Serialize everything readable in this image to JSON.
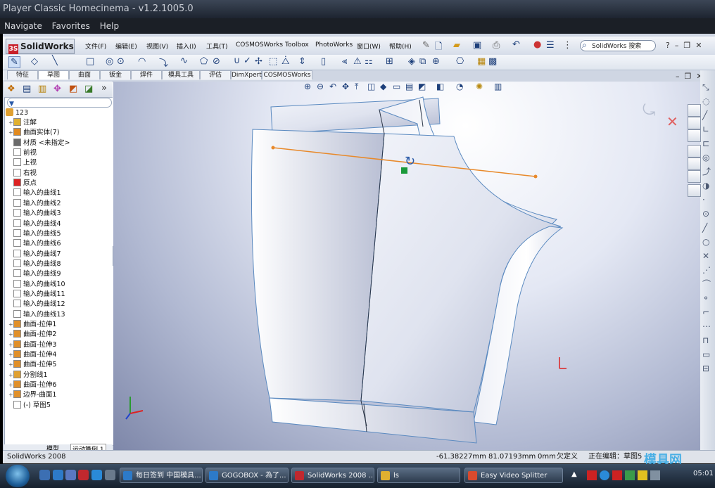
{
  "player": {
    "title": "Player Classic Homecinema - v1.2.1005.0",
    "menu": [
      "Navigate",
      "Favorites",
      "Help"
    ]
  },
  "solidworks": {
    "logo": "SolidWorks",
    "menus": [
      "文件(F)",
      "编辑(E)",
      "视图(V)",
      "插入(I)",
      "工具(T)",
      "COSMOSWorks",
      "Toolbox",
      "PhotoWorks",
      "窗口(W)",
      "帮助(H)"
    ],
    "search_placeholder": "SolidWorks 搜索",
    "command_tabs": [
      "特征",
      "草图",
      "曲面",
      "钣金",
      "焊件",
      "模具工具",
      "评估",
      "DimXpert",
      "COSMOSWorks"
    ],
    "active_tab": "草图"
  },
  "tree": {
    "root": "123",
    "items": [
      {
        "label": "注解",
        "icon": "annotation-icon",
        "expand": "+"
      },
      {
        "label": "曲面实体(7)",
        "icon": "surface-bodies-icon",
        "expand": "+"
      },
      {
        "label": "材质 <未指定>",
        "icon": "material-icon",
        "expand": ""
      },
      {
        "label": "前视",
        "icon": "plane-icon",
        "expand": ""
      },
      {
        "label": "上视",
        "icon": "plane-icon",
        "expand": ""
      },
      {
        "label": "右视",
        "icon": "plane-icon",
        "expand": ""
      },
      {
        "label": "原点",
        "icon": "origin-icon",
        "expand": ""
      },
      {
        "label": "输入的曲线1",
        "icon": "curve-icon",
        "expand": ""
      },
      {
        "label": "输入的曲线2",
        "icon": "curve-icon",
        "expand": ""
      },
      {
        "label": "输入的曲线3",
        "icon": "curve-icon",
        "expand": ""
      },
      {
        "label": "输入的曲线4",
        "icon": "curve-icon",
        "expand": ""
      },
      {
        "label": "输入的曲线5",
        "icon": "curve-icon",
        "expand": ""
      },
      {
        "label": "输入的曲线6",
        "icon": "curve-icon",
        "expand": ""
      },
      {
        "label": "输入的曲线7",
        "icon": "curve-icon",
        "expand": ""
      },
      {
        "label": "输入的曲线8",
        "icon": "curve-icon",
        "expand": ""
      },
      {
        "label": "输入的曲线9",
        "icon": "curve-icon",
        "expand": ""
      },
      {
        "label": "输入的曲线10",
        "icon": "curve-icon",
        "expand": ""
      },
      {
        "label": "输入的曲线11",
        "icon": "curve-icon",
        "expand": ""
      },
      {
        "label": "输入的曲线12",
        "icon": "curve-icon",
        "expand": ""
      },
      {
        "label": "输入的曲线13",
        "icon": "curve-icon",
        "expand": ""
      },
      {
        "label": "曲面-拉伸1",
        "icon": "extrude-icon",
        "expand": "+"
      },
      {
        "label": "曲面-拉伸2",
        "icon": "extrude-icon",
        "expand": "+"
      },
      {
        "label": "曲面-拉伸3",
        "icon": "extrude-icon",
        "expand": "+"
      },
      {
        "label": "曲面-拉伸4",
        "icon": "extrude-icon",
        "expand": "+"
      },
      {
        "label": "曲面-拉伸5",
        "icon": "extrude-icon",
        "expand": "+"
      },
      {
        "label": "分割线1",
        "icon": "split-line-icon",
        "expand": "+"
      },
      {
        "label": "曲面-拉伸6",
        "icon": "extrude-icon",
        "expand": "+"
      },
      {
        "label": "边界-曲面1",
        "icon": "boundary-surface-icon",
        "expand": "+"
      },
      {
        "label": "(-) 草图5",
        "icon": "sketch-icon",
        "expand": ""
      }
    ],
    "bottom_tabs": [
      "模型",
      "运动算例 1"
    ]
  },
  "status": {
    "app": "SolidWorks 2008",
    "x": "-61.38227mm",
    "y": "81.07193mm",
    "z": "0mm",
    "state": "欠定义",
    "editing": "正在编辑：草图5"
  },
  "taskbar": {
    "tasks": [
      "每日签到 中国模具...",
      "GOGOBOX - 為了...",
      "SolidWorks 2008 ...",
      "ls",
      "Easy Video Splitter"
    ],
    "clock": "05:01"
  },
  "watermark": "模具网",
  "colors": {
    "accent_line": "#e8892a",
    "selection_green": "#1a9a3a",
    "surface_edge": "#4a7fb5"
  }
}
